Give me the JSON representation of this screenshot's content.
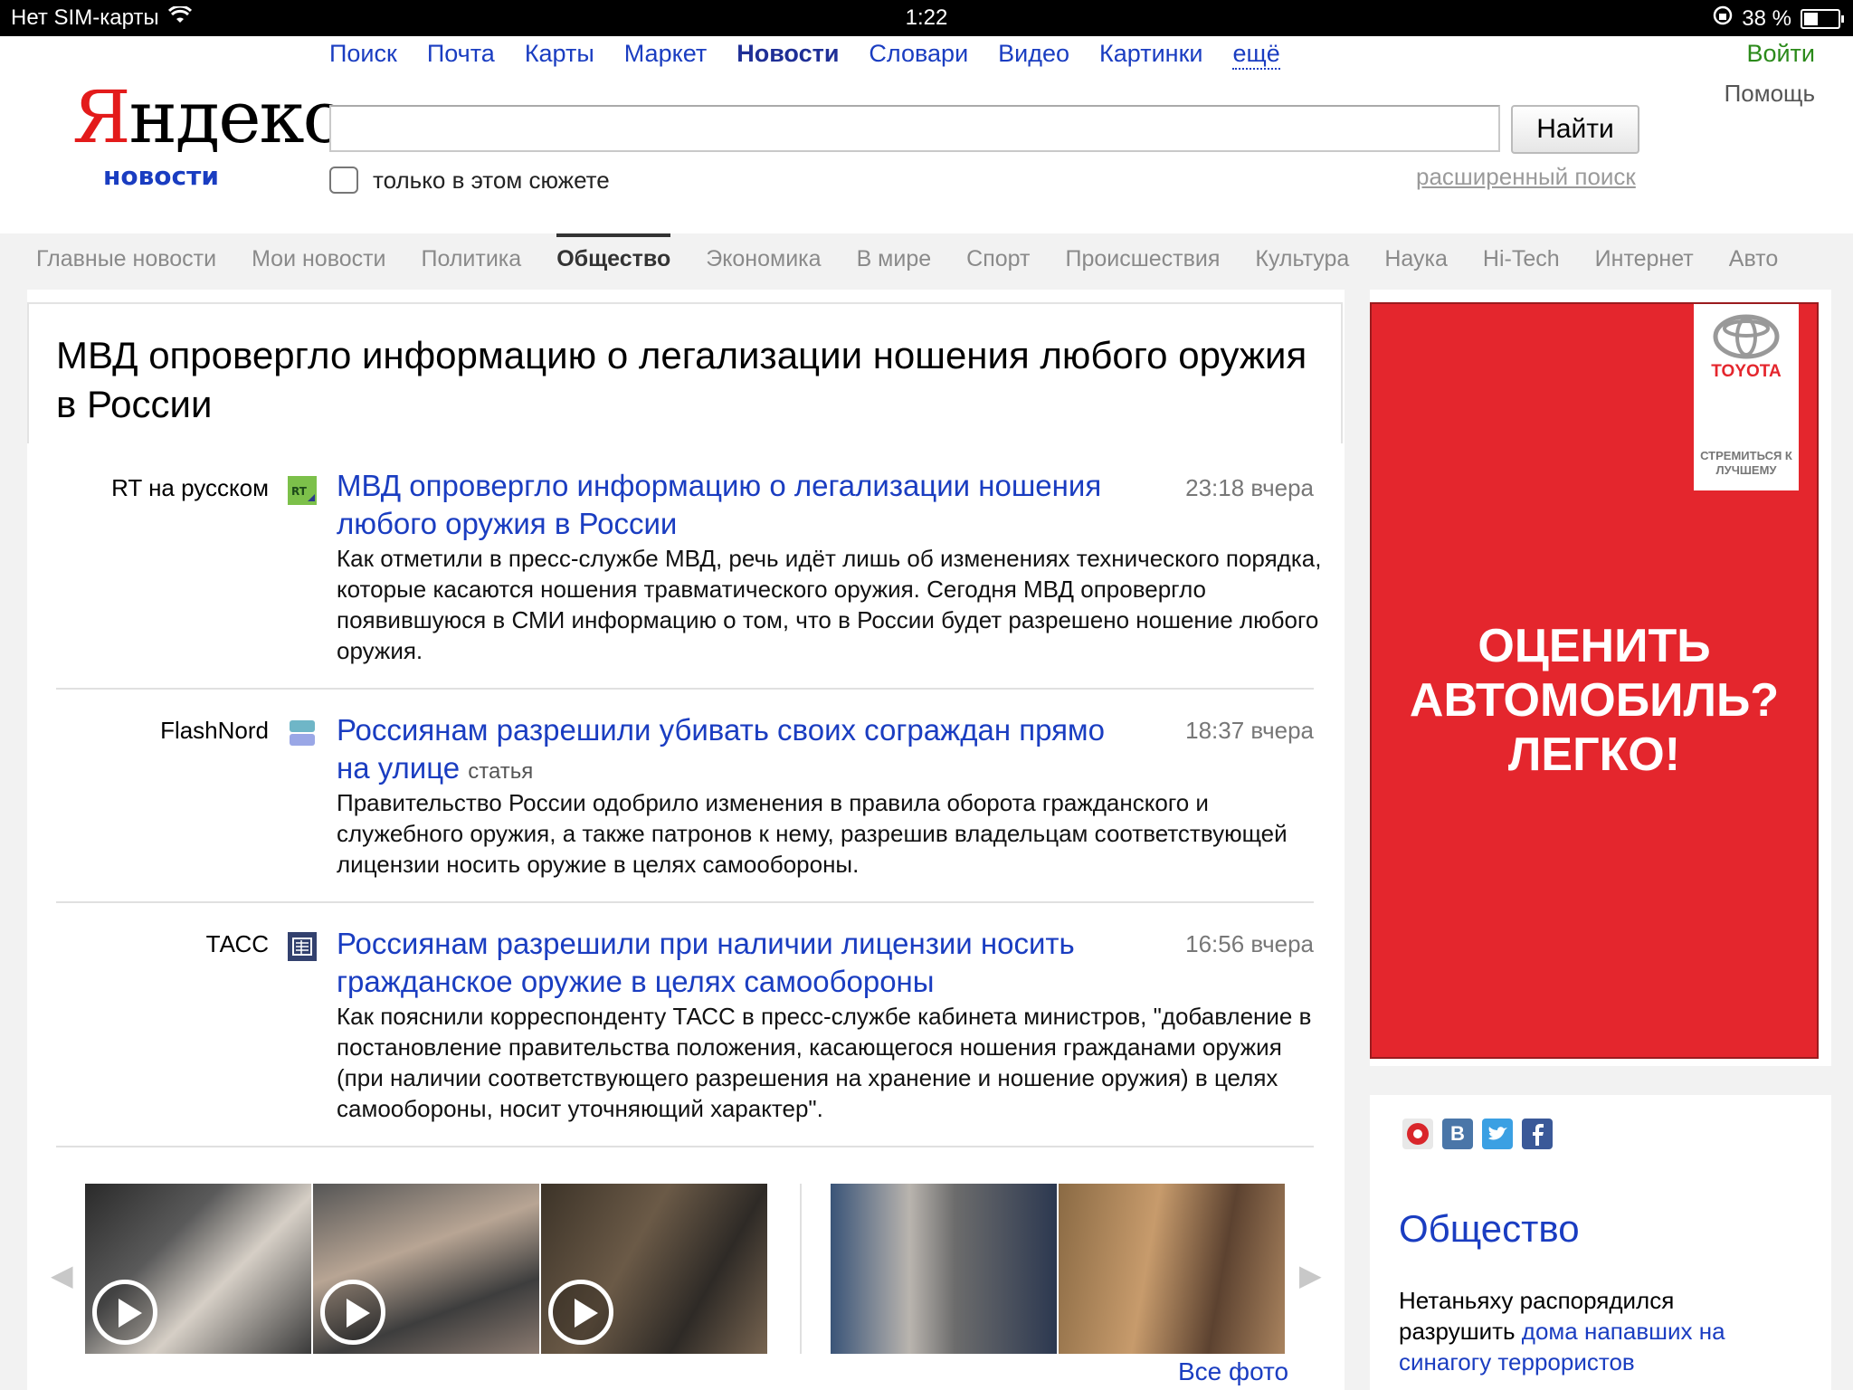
{
  "status_bar": {
    "carrier": "Нет SIM-карты",
    "time": "1:22",
    "battery": "38 %",
    "battery_level": 0.38
  },
  "header": {
    "logo_text_red": "Я",
    "logo_text_black": "ндекс",
    "logo_sub": "новости",
    "nav": [
      "Поиск",
      "Почта",
      "Карты",
      "Маркет",
      "Новости",
      "Словари",
      "Видео",
      "Картинки",
      "ещё"
    ],
    "nav_active": "Новости",
    "login": "Войти",
    "help": "Помощь",
    "search_value": "",
    "search_button": "Найти",
    "only_in_story": "только в этом сюжете",
    "advanced_search": "расширенный поиск"
  },
  "tabs": [
    "Главные новости",
    "Мои новости",
    "Политика",
    "Общество",
    "Экономика",
    "В мире",
    "Спорт",
    "Происшествия",
    "Культура",
    "Наука",
    "Hi-Tech",
    "Интернет",
    "Авто"
  ],
  "active_tab": "Общество",
  "story": {
    "title": "МВД опровергло информацию о легализации ношения любого оружия в России",
    "items": [
      {
        "source": "RT на русском",
        "title": "МВД опровергло информацию о легализации ношения любого оружия в России",
        "tag": "",
        "time": "23:18 вчера",
        "text": "Как отметили в пресс-службе МВД, речь идёт лишь об изменениях технического порядка, которые касаются ношения травматического оружия. Сегодня МВД опровергло появившуюся в СМИ информацию о том, что в России будет разрешено ношение любого оружия."
      },
      {
        "source": "FlashNord",
        "title": "Россиянам разрешили убивать своих сограждан прямо на улице",
        "tag": "статья",
        "time": "18:37 вчера",
        "text": "Правительство России одобрило изменения в правила оборота гражданского и служебного оружия, а также патронов к нему, разрешив владельцам соответствующей лицензии носить оружие в целях самообороны."
      },
      {
        "source": "ТАСС",
        "title": "Россиянам разрешили при наличии лицензии носить гражданское оружие в целях самообороны",
        "tag": "",
        "time": "16:56 вчера",
        "text": "Как пояснили корреспонденту ТАСС в пресс-службе кабинета министров, \"добавление в постановление правительства положения, касающегося ношения гражданами оружия (при наличии соответствующего разрешения на хранение и ношение оружия) в целях самообороны, носит уточняющий характер\"."
      }
    ]
  },
  "gallery": {
    "all_photo": "Все фото"
  },
  "ad": {
    "brand": "TOYOTA",
    "slogan": "СТРЕМИТЬСЯ К ЛУЧШЕМУ",
    "text": "ОЦЕНИТЬ АВТОМОБИЛЬ? ЛЕГКО!"
  },
  "social": [
    "В"
  ],
  "right_column": {
    "title": "Общество",
    "text_plain": "Нетаньяху распорядился разрушить ",
    "text_link": "дома напавших на синагогу террористов"
  }
}
